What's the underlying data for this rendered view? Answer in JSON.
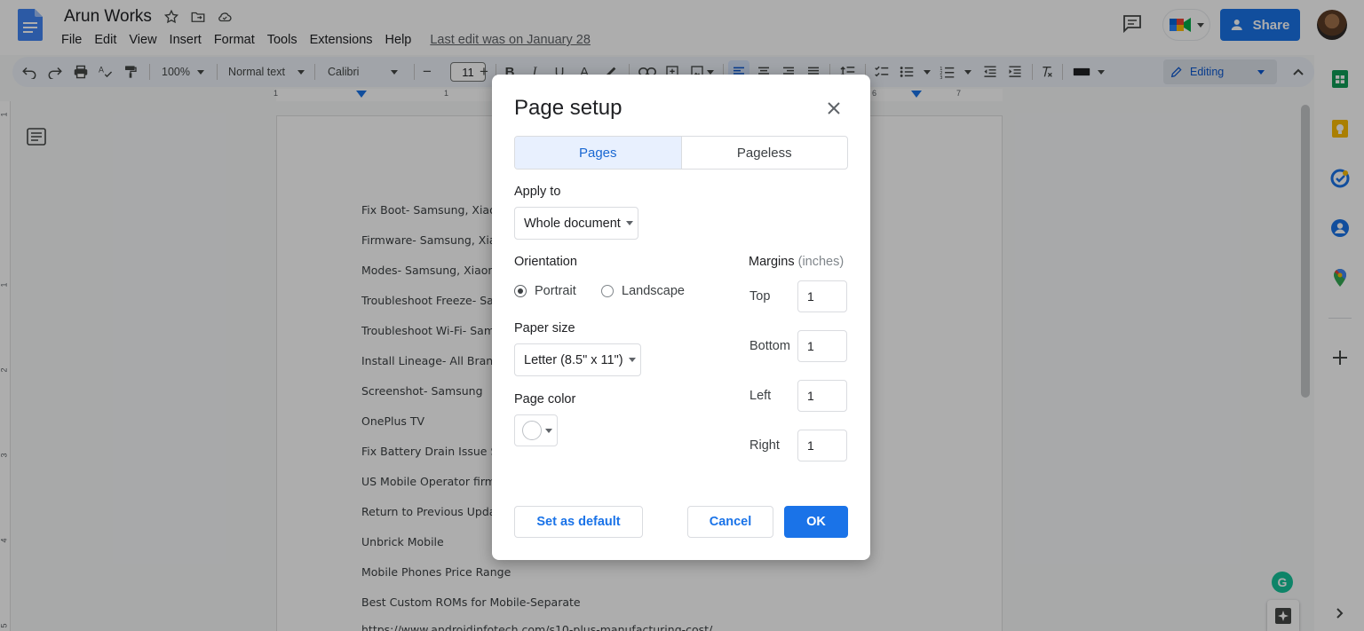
{
  "header": {
    "doc_title": "Arun Works",
    "menu": [
      "File",
      "Edit",
      "View",
      "Insert",
      "Format",
      "Tools",
      "Extensions",
      "Help"
    ],
    "last_edit": "Last edit was on January 28",
    "share_label": "Share"
  },
  "toolbar": {
    "zoom": "100%",
    "style": "Normal text",
    "font": "Calibri",
    "font_size": "11",
    "mode": "Editing"
  },
  "ruler": {
    "marks": [
      "1",
      "1",
      "6",
      "7"
    ]
  },
  "vruler": {
    "marks": [
      "1",
      "1",
      "2",
      "3",
      "4",
      "5"
    ]
  },
  "document": {
    "lines": [
      "Fix Boot- Samsung, Xiaom",
      "Firmware- Samsung, Xiao",
      "Modes- Samsung, Xiaom",
      "Troubleshoot Freeze- Sar",
      "Troubleshoot Wi-Fi- Sam",
      "Install Lineage- All Brand",
      "Screenshot- Samsung",
      "OnePlus TV",
      "Fix Battery Drain Issue Sa",
      "US Mobile Operator firm",
      "Return to Previous Upda",
      "Unbrick Mobile",
      "Mobile Phones Price Range",
      "Best Custom ROMs for Mobile-Separate",
      "https://www.androidinfotech.com/s10-plus-manufacturing-cost/"
    ]
  },
  "dialog": {
    "title": "Page setup",
    "tabs": [
      "Pages",
      "Pageless"
    ],
    "apply_to_label": "Apply to",
    "apply_to_value": "Whole document",
    "orientation_label": "Orientation",
    "orientation_options": [
      "Portrait",
      "Landscape"
    ],
    "orientation_selected": "Portrait",
    "paper_size_label": "Paper size",
    "paper_size_value": "Letter (8.5\" x 11\")",
    "page_color_label": "Page color",
    "page_color_value": "#ffffff",
    "margins_label": "Margins",
    "margins_unit": "(inches)",
    "margins": [
      {
        "label": "Top",
        "value": "1"
      },
      {
        "label": "Bottom",
        "value": "1"
      },
      {
        "label": "Left",
        "value": "1"
      },
      {
        "label": "Right",
        "value": "1"
      }
    ],
    "set_default_label": "Set as default",
    "cancel_label": "Cancel",
    "ok_label": "OK"
  },
  "side_panel": {
    "icons": [
      "sheets-icon",
      "keep-icon",
      "tasks-icon",
      "contacts-icon",
      "maps-icon",
      "add-icon"
    ]
  },
  "colors": {
    "accent": "#1a73e8",
    "toolbar_bg": "#edf2fa"
  }
}
